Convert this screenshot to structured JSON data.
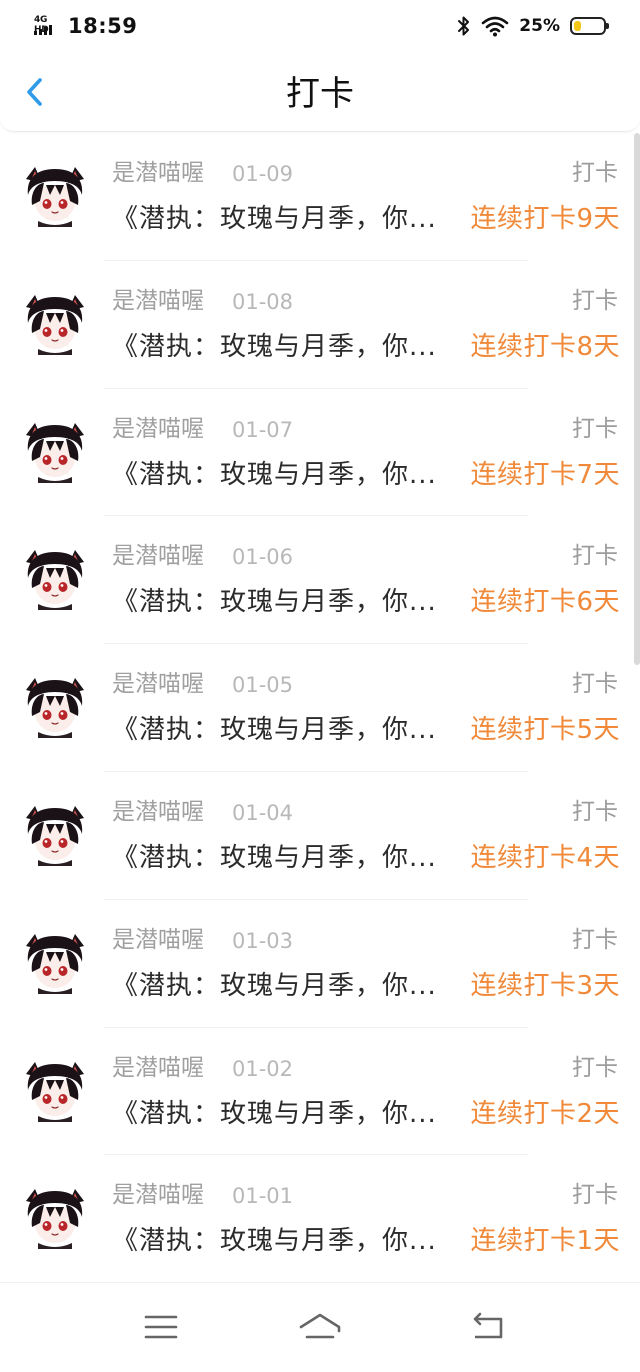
{
  "status_bar": {
    "network": "4G HD",
    "time": "18:59",
    "battery_percent": "25%",
    "battery_level": 0.25,
    "icons": [
      "signal-icon",
      "bluetooth-icon",
      "wifi-icon",
      "battery-icon"
    ]
  },
  "header": {
    "title": "打卡",
    "back_icon": "chevron-left-icon"
  },
  "list": {
    "items": [
      {
        "name": "是潜喵喔",
        "date": "01-09",
        "type": "打卡",
        "content": "《潜执：玫瑰与月季，你...",
        "streak": "连续打卡9天"
      },
      {
        "name": "是潜喵喔",
        "date": "01-08",
        "type": "打卡",
        "content": "《潜执：玫瑰与月季，你...",
        "streak": "连续打卡8天"
      },
      {
        "name": "是潜喵喔",
        "date": "01-07",
        "type": "打卡",
        "content": "《潜执：玫瑰与月季，你...",
        "streak": "连续打卡7天"
      },
      {
        "name": "是潜喵喔",
        "date": "01-06",
        "type": "打卡",
        "content": "《潜执：玫瑰与月季，你...",
        "streak": "连续打卡6天"
      },
      {
        "name": "是潜喵喔",
        "date": "01-05",
        "type": "打卡",
        "content": "《潜执：玫瑰与月季，你...",
        "streak": "连续打卡5天"
      },
      {
        "name": "是潜喵喔",
        "date": "01-04",
        "type": "打卡",
        "content": "《潜执：玫瑰与月季，你...",
        "streak": "连续打卡4天"
      },
      {
        "name": "是潜喵喔",
        "date": "01-03",
        "type": "打卡",
        "content": "《潜执：玫瑰与月季，你...",
        "streak": "连续打卡3天"
      },
      {
        "name": "是潜喵喔",
        "date": "01-02",
        "type": "打卡",
        "content": "《潜执：玫瑰与月季，你...",
        "streak": "连续打卡2天"
      },
      {
        "name": "是潜喵喔",
        "date": "01-01",
        "type": "打卡",
        "content": "《潜执：玫瑰与月季，你...",
        "streak": "连续打卡1天"
      }
    ]
  },
  "navbar": {
    "icons": [
      "menu-icon",
      "home-icon",
      "back-icon"
    ]
  },
  "colors": {
    "accent": "#2f9be9",
    "streak": "#f08a3a",
    "name_gray": "#a0a0a0",
    "content_text": "#2b2b2b",
    "battery_fill": "#f5c518"
  }
}
